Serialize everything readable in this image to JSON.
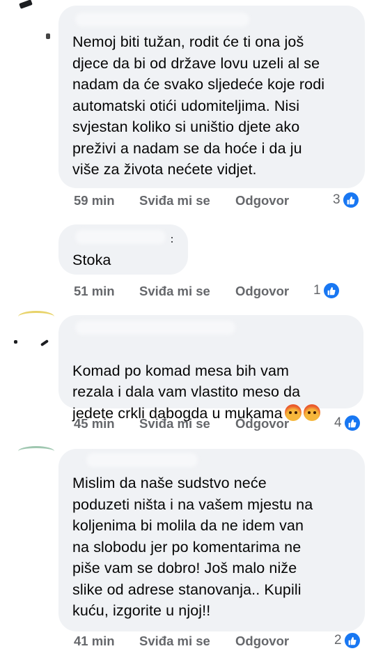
{
  "comments": [
    {
      "text": "Nemoj biti tužan, rodit će ti ona još\ndjece da bi od države lovu uzeli al se\nnadam da će svako sljedeće koje rodi\nautomatski otići udomiteljima. Nisi\nsvjestan koliko si uništio djete ako\npreživi a nadam se da hoće i da ju\nviše za života nećete vidjet.",
      "time": "59 min",
      "like_label": "Sviđa mi se",
      "reply_label": "Odgovor",
      "reaction_count": "3"
    },
    {
      "text": "Stoka",
      "time": "51 min",
      "like_label": "Sviđa mi se",
      "reply_label": "Odgovor",
      "reaction_count": "1"
    },
    {
      "text": "Komad po komad mesa bih vam\nrezala i dala vam vlastito meso da\njedete crkli dabogda u mukama",
      "time": "45 min",
      "like_label": "Sviđa mi se",
      "reply_label": "Odgovor",
      "reaction_count": "4"
    },
    {
      "text": "Mislim da naše sudstvo neće\npoduzeti ništa i na vašem mjestu na\nkoljenima bi molila da ne idem van\nna slobodu jer po komentarima ne\npiše vam se dobro! Još malo niže\nslike od adrese stanovanja.. Kupili\nkuću, izgorite u njoj!!",
      "time": "41 min",
      "like_label": "Sviđa mi se",
      "reply_label": "Odgovor",
      "reaction_count": "2"
    }
  ],
  "icons": {
    "reaction": "like-icon",
    "emoji": "angry-face-icon"
  },
  "colors": {
    "bubble": "#f0f2f5",
    "meta": "#65676b",
    "like": "#1877f2"
  }
}
